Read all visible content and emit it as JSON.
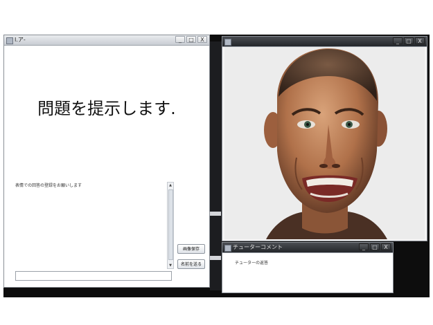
{
  "left_window": {
    "title": "Ⅰ.ア-",
    "problem_text": "問題を提示します.",
    "log_text": "表情での回答の登録をお願いします",
    "button_top": "画像保存",
    "button_bottom": "名前を送る",
    "input_value": ""
  },
  "right_window": {
    "title": "",
    "face_description_icon": "face-image"
  },
  "bottom_window": {
    "title": "チューターコメント",
    "comment_text": "チューターの返答"
  },
  "window_controls": {
    "minimize": "_",
    "maximize": "□",
    "close": "X"
  }
}
